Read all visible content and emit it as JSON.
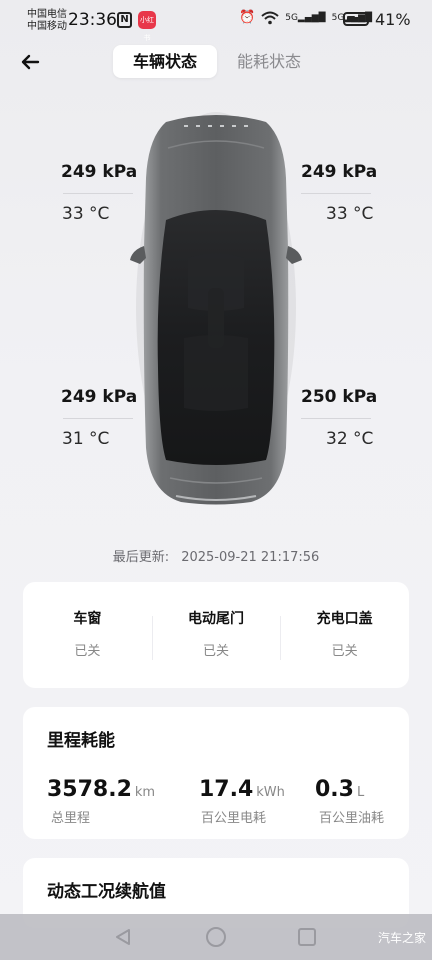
{
  "status_bar": {
    "carrier_1": "中国电信",
    "carrier_2": "中国移动",
    "time": "23:36",
    "nfc": "N",
    "app_badge": "小红书",
    "signal_1": "5G",
    "signal_2": "5G",
    "battery": "41%"
  },
  "header": {
    "tabs": [
      {
        "label": "车辆状态",
        "active": true
      },
      {
        "label": "能耗状态",
        "active": false
      }
    ]
  },
  "tires": {
    "front_left": {
      "pressure": "249 kPa",
      "temp": "33 °C"
    },
    "front_right": {
      "pressure": "249 kPa",
      "temp": "33 °C"
    },
    "rear_left": {
      "pressure": "249 kPa",
      "temp": "31 °C"
    },
    "rear_right": {
      "pressure": "250 kPa",
      "temp": "32 °C"
    }
  },
  "last_update": {
    "label": "最后更新:",
    "value": "2025-09-21 21:17:56"
  },
  "status": [
    {
      "label": "车窗",
      "value": "已关"
    },
    {
      "label": "电动尾门",
      "value": "已关"
    },
    {
      "label": "充电口盖",
      "value": "已关"
    }
  ],
  "mileage": {
    "title": "里程耗能",
    "odometer": {
      "value": "3578.2",
      "unit": "km",
      "label": "总里程"
    },
    "power": {
      "value": "17.4",
      "unit": "kWh",
      "label": "百公里电耗"
    },
    "fuel": {
      "value": "0.3",
      "unit": "L",
      "label": "百公里油耗"
    }
  },
  "range": {
    "title": "动态工况续航值"
  },
  "watermark": "汽车之家"
}
